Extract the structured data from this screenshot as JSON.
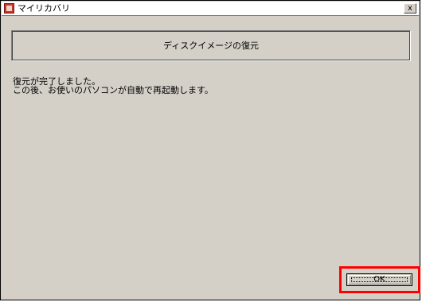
{
  "window": {
    "title": "マイリカバリ",
    "close_label": "x"
  },
  "header": {
    "title": "ディスクイメージの復元"
  },
  "message": {
    "line1": "復元が完了しました。",
    "line2": "この後、お使いのパソコンが自動で再起動します。"
  },
  "buttons": {
    "ok_label": "OK"
  },
  "colors": {
    "face": "#d4d0c8",
    "highlight": "#ff0000",
    "icon": "#c0392b"
  },
  "icons": {
    "app": "app-icon",
    "close": "close-icon"
  }
}
